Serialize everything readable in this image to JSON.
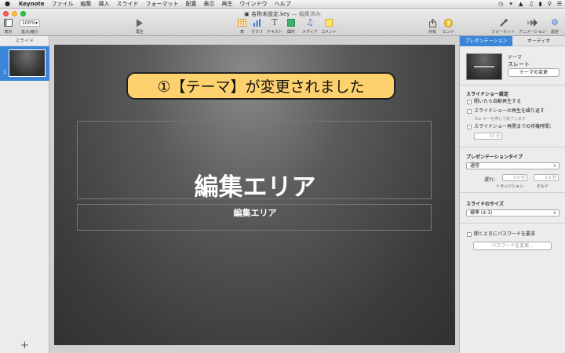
{
  "menubar": {
    "app": "Keynote",
    "items": [
      "ファイル",
      "編集",
      "挿入",
      "スライド",
      "フォーマット",
      "配置",
      "表示",
      "再生",
      "ウインドウ",
      "ヘルプ"
    ]
  },
  "window": {
    "title": "名称未設定.key",
    "status": "— 編集済み"
  },
  "toolbar": {
    "view": "表示",
    "zoom_value": "100%",
    "zoom_label": "拡大/縮小",
    "play": "再生",
    "table": "表",
    "chart": "グラフ",
    "text": "テキスト",
    "shape": "図形",
    "media": "メディア",
    "comment": "コメント",
    "share": "共有",
    "tips": "ヒント",
    "format": "フォーマット",
    "animate": "アニメーション",
    "document": "設定"
  },
  "navigator": {
    "header": "スライド",
    "slide_number": "1",
    "add_label": "+"
  },
  "slide": {
    "callout": "①【テーマ】が変更されました",
    "title": "編集エリア",
    "subtitle": "編集エリア"
  },
  "inspector": {
    "tabs": [
      "プレゼンテーション",
      "オーディオ"
    ],
    "theme_label": "テーマ",
    "theme_name": "スレート",
    "change_theme_button": "テーマの変更",
    "slideshow_section": "スライドショー設定",
    "autoplay": "開いたら自動再生する",
    "loop": "スライドショーの再生を繰り返す",
    "loop_hint": "Esc キーを押して終了します",
    "idle_restart": "スライドショー再開までの待機時間：",
    "idle_value": "15 分",
    "presentation_type_section": "プレゼンテーションタイプ",
    "presentation_type_value": "通常",
    "delay_label": "遅れ：",
    "transition_delay": "5.0 秒",
    "build_delay": "2.0 秒",
    "transition_label": "トランジション",
    "build_label": "ビルド",
    "slide_size_section": "スライドのサイズ",
    "slide_size_value": "標準 (4:3)",
    "password_checkbox": "開くときにパスワードを要求",
    "password_button": "パスワードを変更..."
  }
}
